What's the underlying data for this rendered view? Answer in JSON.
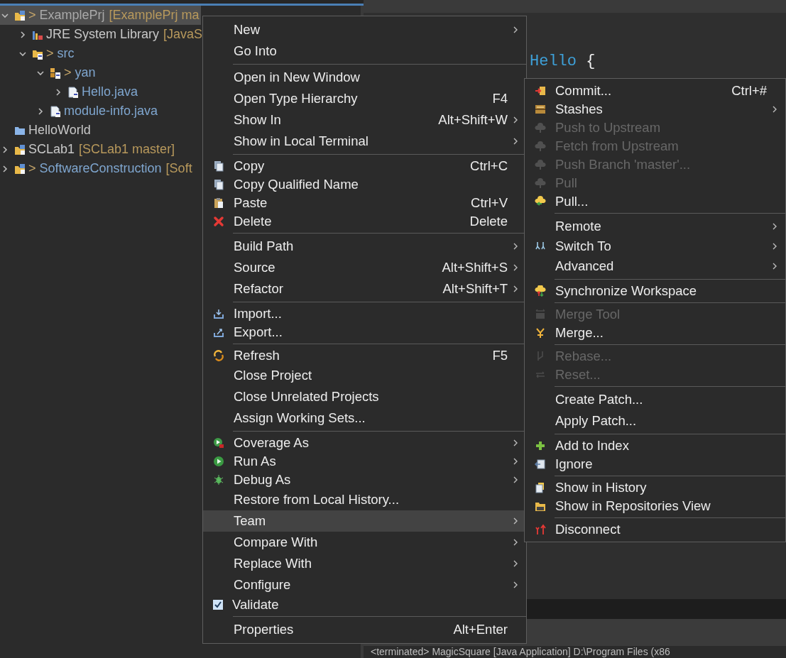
{
  "project_explorer": {
    "tree": [
      {
        "kind": "project",
        "marker": ">",
        "label": "ExamplePrj",
        "decoration": "[ExamplePrj ma",
        "expanded": true,
        "selected": true,
        "changed": false,
        "children": [
          {
            "kind": "library",
            "label": "JRE System Library",
            "decoration": "[JavaS",
            "expanded": false,
            "selected": false,
            "changed": false
          },
          {
            "kind": "source-folder",
            "marker": ">",
            "label": "src",
            "expanded": true,
            "selected": false,
            "changed": true,
            "children": [
              {
                "kind": "package",
                "marker": ">",
                "label": "yan",
                "expanded": true,
                "selected": false,
                "changed": true,
                "children": [
                  {
                    "kind": "file",
                    "label": "Hello.java",
                    "expanded": false,
                    "selected": false,
                    "changed": true
                  }
                ]
              },
              {
                "kind": "file",
                "label": "module-info.java",
                "expanded": false,
                "selected": false,
                "changed": true
              }
            ]
          }
        ]
      },
      {
        "kind": "closed-project",
        "label": "HelloWorld",
        "selected": false,
        "changed": false
      },
      {
        "kind": "project",
        "label": "SCLab1",
        "decoration": "[SCLab1 master]",
        "expanded": false,
        "selected": false,
        "changed": false
      },
      {
        "kind": "project",
        "marker": ">",
        "label": "SoftwareConstruction",
        "decoration": "[Soft",
        "expanded": false,
        "selected": false,
        "changed": true
      }
    ]
  },
  "editor": {
    "lines": [
      {
        "tokens": [
          {
            "kind": "type",
            "text": "Hello"
          },
          {
            "kind": "plain",
            "text": " {"
          }
        ]
      }
    ]
  },
  "console": {
    "text": "<terminated> MagicSquare [Java Application] D:\\Program Files (x86"
  },
  "context_menu": {
    "items": [
      {
        "kind": "item",
        "label": "New",
        "submenu": true,
        "selected": false
      },
      {
        "kind": "item",
        "label": "Go Into",
        "submenu": false,
        "selected": false
      },
      {
        "kind": "separator"
      },
      {
        "kind": "item",
        "label": "Open in New Window",
        "submenu": false,
        "selected": false
      },
      {
        "kind": "item",
        "label": "Open Type Hierarchy",
        "shortcut": "F4",
        "submenu": false,
        "selected": false
      },
      {
        "kind": "item",
        "label": "Show In",
        "shortcut": "Alt+Shift+W",
        "submenu": true,
        "selected": false
      },
      {
        "kind": "item",
        "label": "Show in Local Terminal",
        "submenu": true,
        "selected": false
      },
      {
        "kind": "separator"
      },
      {
        "kind": "item",
        "label": "Copy",
        "shortcut": "Ctrl+C",
        "submenu": false,
        "selected": false
      },
      {
        "kind": "item",
        "label": "Copy Qualified Name",
        "submenu": false,
        "selected": false
      },
      {
        "kind": "item",
        "label": "Paste",
        "shortcut": "Ctrl+V",
        "submenu": false,
        "selected": false
      },
      {
        "kind": "item",
        "label": "Delete",
        "shortcut": "Delete",
        "submenu": false,
        "selected": false
      },
      {
        "kind": "separator"
      },
      {
        "kind": "item",
        "label": "Build Path",
        "submenu": true,
        "selected": false
      },
      {
        "kind": "item",
        "label": "Source",
        "shortcut": "Alt+Shift+S",
        "submenu": true,
        "selected": false
      },
      {
        "kind": "item",
        "label": "Refactor",
        "shortcut": "Alt+Shift+T",
        "submenu": true,
        "selected": false
      },
      {
        "kind": "separator"
      },
      {
        "kind": "item",
        "label": "Import...",
        "submenu": false,
        "selected": false
      },
      {
        "kind": "item",
        "label": "Export...",
        "submenu": false,
        "selected": false
      },
      {
        "kind": "separator"
      },
      {
        "kind": "item",
        "label": "Refresh",
        "shortcut": "F5",
        "submenu": false,
        "selected": false
      },
      {
        "kind": "item",
        "label": "Close Project",
        "submenu": false,
        "selected": false
      },
      {
        "kind": "item",
        "label": "Close Unrelated Projects",
        "submenu": false,
        "selected": false
      },
      {
        "kind": "item",
        "label": "Assign Working Sets...",
        "submenu": false,
        "selected": false
      },
      {
        "kind": "separator"
      },
      {
        "kind": "item",
        "label": "Coverage As",
        "submenu": true,
        "selected": false
      },
      {
        "kind": "item",
        "label": "Run As",
        "submenu": true,
        "selected": false
      },
      {
        "kind": "item",
        "label": "Debug As",
        "submenu": true,
        "selected": false
      },
      {
        "kind": "item",
        "label": "Restore from Local History...",
        "submenu": false,
        "selected": false
      },
      {
        "kind": "item",
        "label": "Team",
        "submenu": true,
        "selected": true
      },
      {
        "kind": "item",
        "label": "Compare With",
        "submenu": true,
        "selected": false
      },
      {
        "kind": "item",
        "label": "Replace With",
        "submenu": true,
        "selected": false
      },
      {
        "kind": "item",
        "label": "Configure",
        "submenu": true,
        "selected": false
      },
      {
        "kind": "item",
        "label": "Validate",
        "submenu": false,
        "selected": false,
        "checked": true
      },
      {
        "kind": "separator"
      },
      {
        "kind": "item",
        "label": "Properties",
        "shortcut": "Alt+Enter",
        "submenu": false,
        "selected": false
      }
    ]
  },
  "team_submenu": {
    "items": [
      {
        "kind": "item",
        "label": "Commit...",
        "shortcut": "Ctrl+#",
        "submenu": false,
        "disabled": false
      },
      {
        "kind": "item",
        "label": "Stashes",
        "submenu": true,
        "disabled": false
      },
      {
        "kind": "item",
        "label": "Push to Upstream",
        "submenu": false,
        "disabled": true
      },
      {
        "kind": "item",
        "label": "Fetch from Upstream",
        "submenu": false,
        "disabled": true
      },
      {
        "kind": "item",
        "label": "Push Branch 'master'...",
        "submenu": false,
        "disabled": true
      },
      {
        "kind": "item",
        "label": "Pull",
        "submenu": false,
        "disabled": true
      },
      {
        "kind": "item",
        "label": "Pull...",
        "submenu": false,
        "disabled": false
      },
      {
        "kind": "separator"
      },
      {
        "kind": "item",
        "label": "Remote",
        "submenu": true,
        "disabled": false
      },
      {
        "kind": "item",
        "label": "Switch To",
        "submenu": true,
        "disabled": false
      },
      {
        "kind": "item",
        "label": "Advanced",
        "submenu": true,
        "disabled": false
      },
      {
        "kind": "separator"
      },
      {
        "kind": "item",
        "label": "Synchronize Workspace",
        "submenu": false,
        "disabled": false
      },
      {
        "kind": "separator"
      },
      {
        "kind": "item",
        "label": "Merge Tool",
        "submenu": false,
        "disabled": true
      },
      {
        "kind": "item",
        "label": "Merge...",
        "submenu": false,
        "disabled": false
      },
      {
        "kind": "separator"
      },
      {
        "kind": "item",
        "label": "Rebase...",
        "submenu": false,
        "disabled": true
      },
      {
        "kind": "item",
        "label": "Reset...",
        "submenu": false,
        "disabled": true
      },
      {
        "kind": "separator"
      },
      {
        "kind": "item",
        "label": "Create Patch...",
        "submenu": false,
        "disabled": false
      },
      {
        "kind": "item",
        "label": "Apply Patch...",
        "submenu": false,
        "disabled": false
      },
      {
        "kind": "separator"
      },
      {
        "kind": "item",
        "label": "Add to Index",
        "submenu": false,
        "disabled": false
      },
      {
        "kind": "item",
        "label": "Ignore",
        "submenu": false,
        "disabled": false
      },
      {
        "kind": "separator"
      },
      {
        "kind": "item",
        "label": "Show in History",
        "submenu": false,
        "disabled": false
      },
      {
        "kind": "item",
        "label": "Show in Repositories View",
        "submenu": false,
        "disabled": false
      },
      {
        "kind": "separator"
      },
      {
        "kind": "item",
        "label": "Disconnect",
        "submenu": false,
        "disabled": false
      }
    ]
  }
}
